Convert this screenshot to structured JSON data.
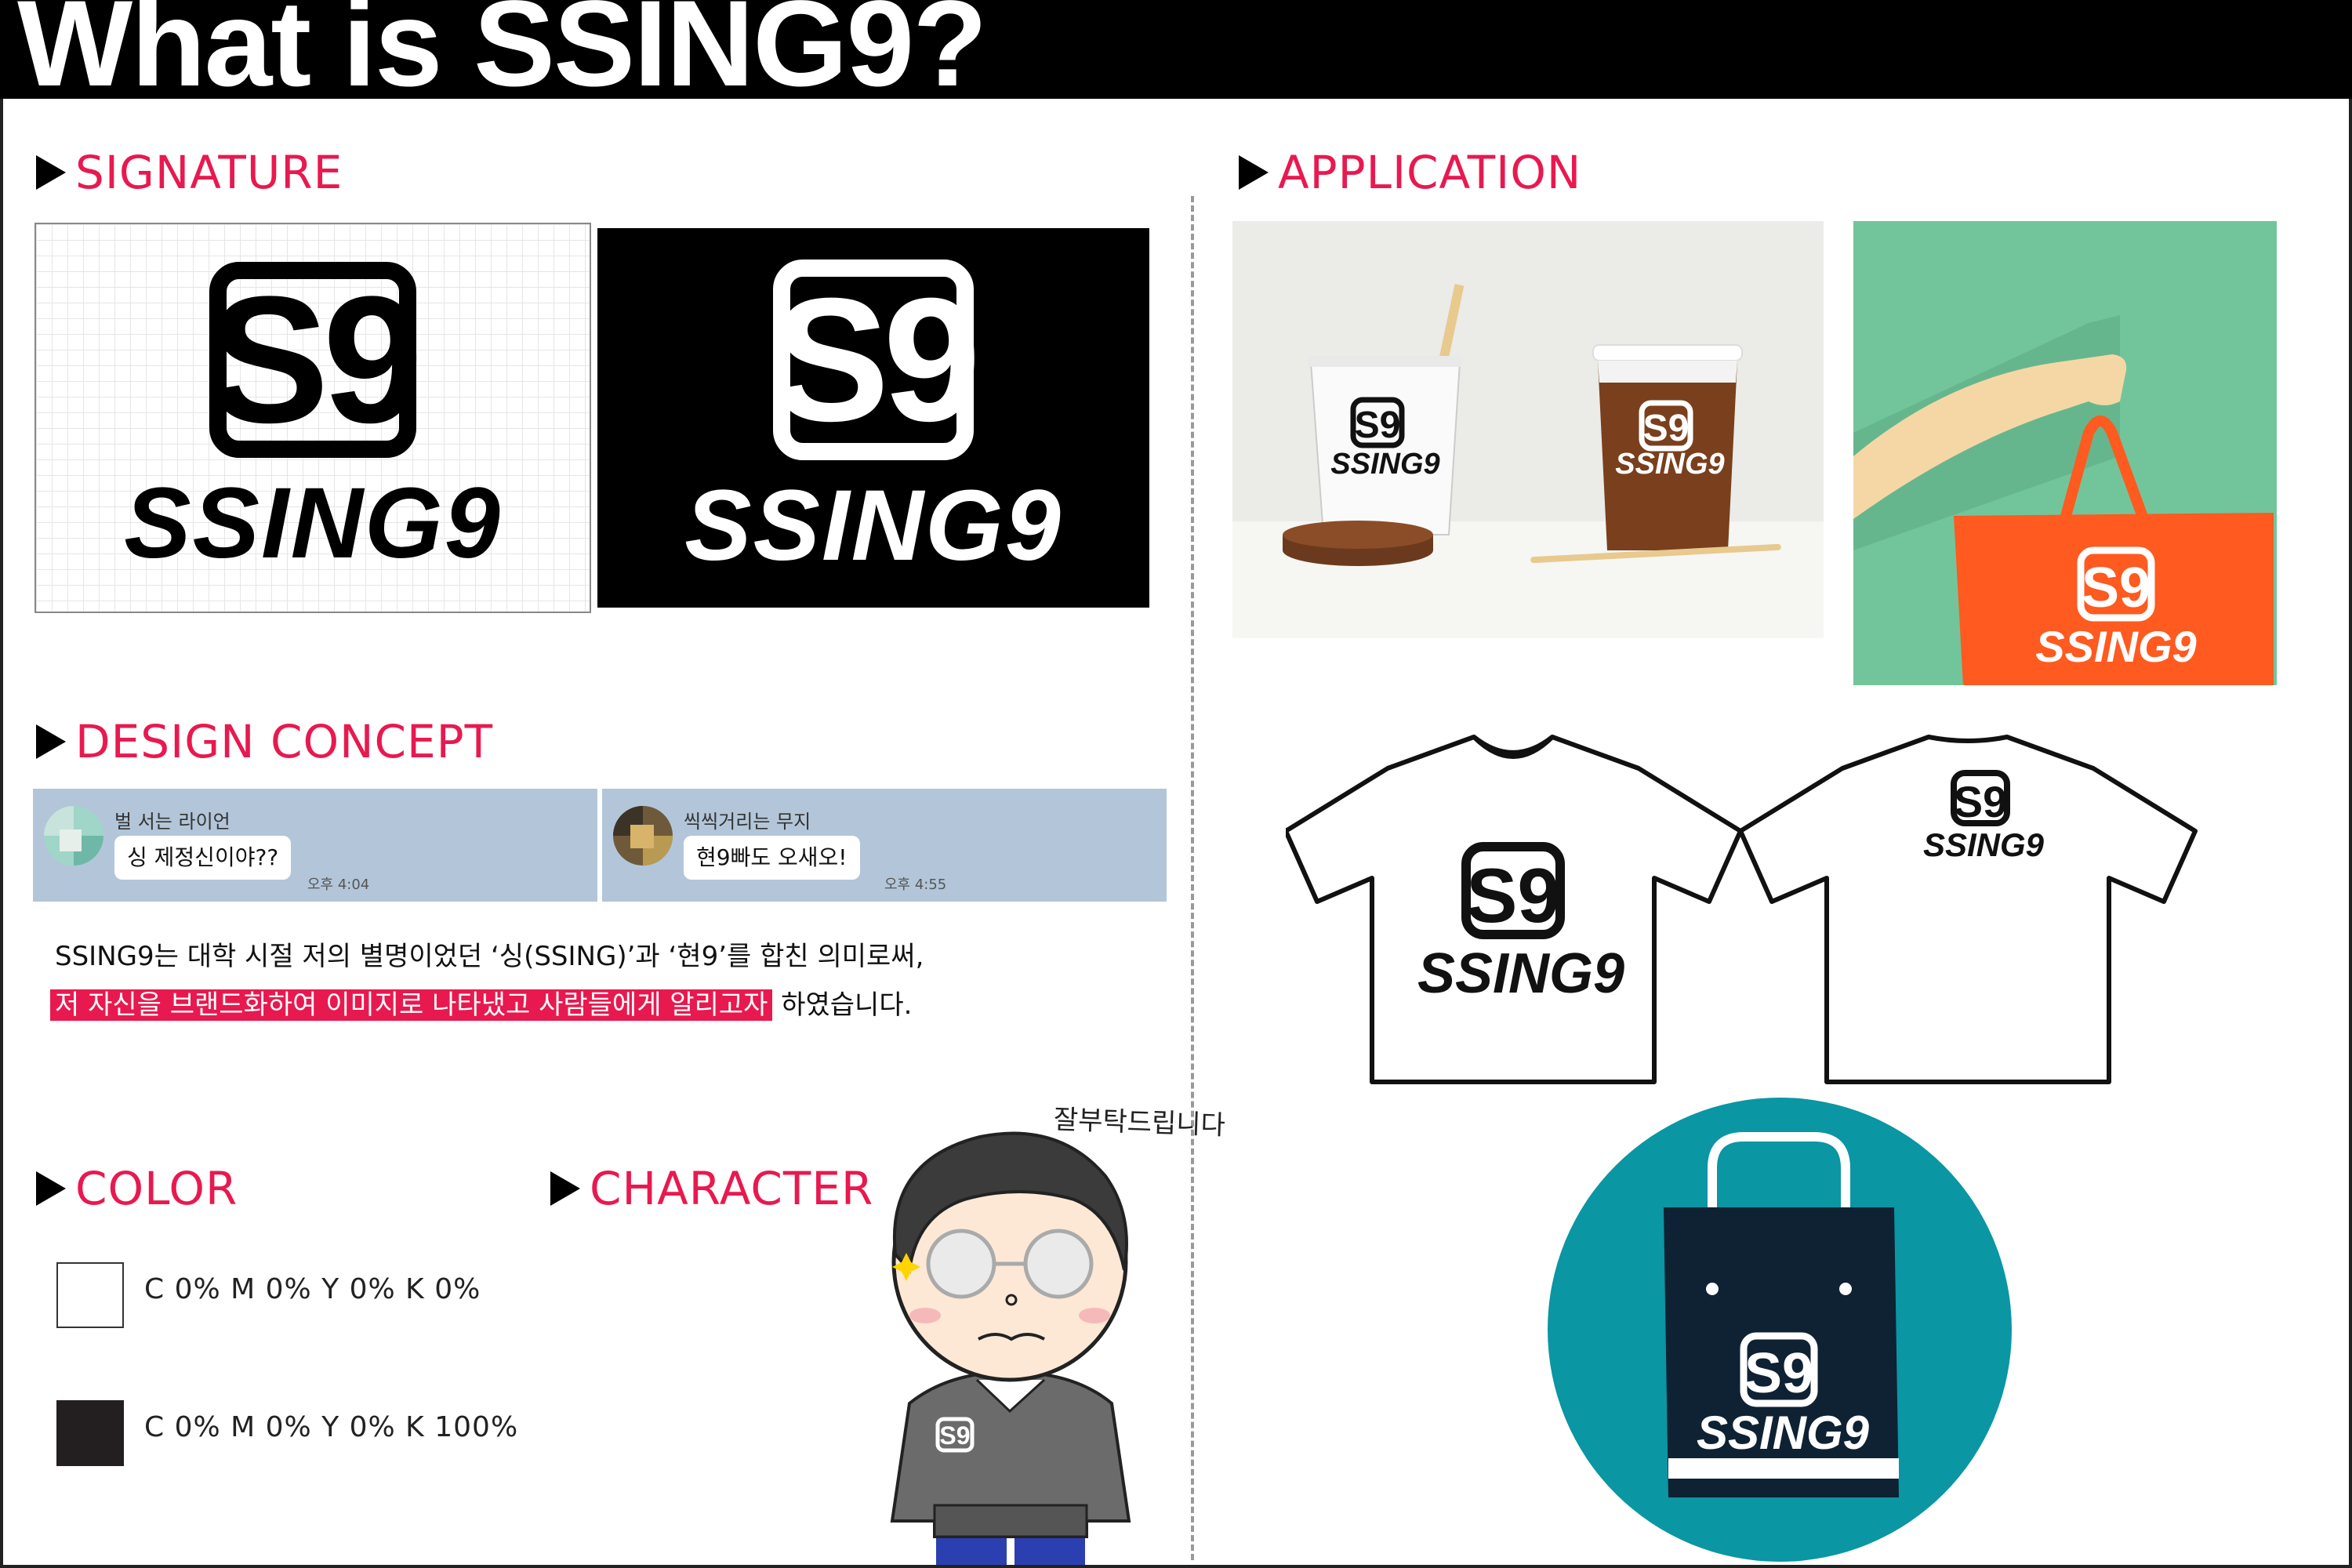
{
  "page": {
    "title": "What is SSING9?"
  },
  "sections": {
    "signature": "SIGNATURE",
    "application": "APPLICATION",
    "design_concept": "DESIGN CONCEPT",
    "color": "COLOR",
    "character": "CHARACTER"
  },
  "logo": {
    "mark": "S9",
    "wordmark": "SSING9"
  },
  "chats": [
    {
      "name": "벌 서는 라이언",
      "message": "싱 제정신이야??",
      "time": "오후 4:04"
    },
    {
      "name": "씩씩거리는 무지",
      "message": "현9빠도 오새오!",
      "time": "오후 4:55"
    }
  ],
  "description": {
    "line1": "SSING9는 대학 시절 저의 별명이었던 ‘싱(SSING)’과 ‘현9’를 합친 의미로써,",
    "highlight": "저 자신을 브랜드화하여 이미지로 나타냈고 사람들에게 알리고자",
    "line2_rest": " 하였습니다."
  },
  "colors": [
    {
      "label": "C 0% M 0% Y 0% K 0%",
      "hex": "#ffffff"
    },
    {
      "label": "C 0% M 0% Y 0% K 100%",
      "hex": "#231f20"
    }
  ],
  "character": {
    "caption": "잘부탁드립니다"
  },
  "theme": {
    "accent": "#e8194f",
    "chat_bg": "#b3c6d9",
    "shopping_bag": "#ff5a1f",
    "panel_green": "#72c59a",
    "circle_teal": "#0a96a3",
    "cup_brown": "#7a3f1c",
    "navy_bag": "#0e2233"
  },
  "icons": [
    "play-triangle-icon",
    "shopping-bag-icon",
    "coffee-cup-icon",
    "t-shirt-icon"
  ]
}
